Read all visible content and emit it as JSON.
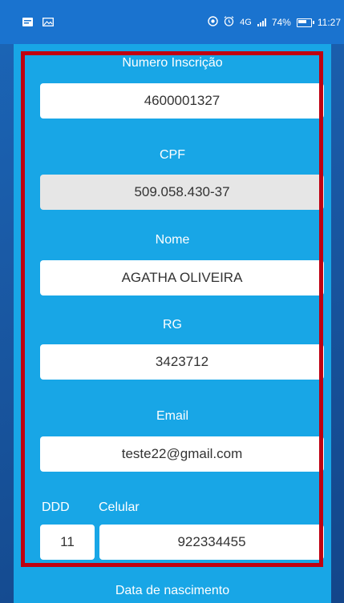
{
  "status_bar": {
    "network": "4G",
    "battery": "74%",
    "time": "11:27"
  },
  "form": {
    "numero_inscricao": {
      "label": "Numero Inscrição",
      "value": "4600001327"
    },
    "cpf": {
      "label": "CPF",
      "value": "509.058.430-37"
    },
    "nome": {
      "label": "Nome",
      "value": "AGATHA OLIVEIRA"
    },
    "rg": {
      "label": "RG",
      "value": "3423712"
    },
    "email": {
      "label": "Email",
      "value": "teste22@gmail.com"
    },
    "ddd": {
      "label": "DDD",
      "value": "11"
    },
    "celular": {
      "label": "Celular",
      "value": "922334455"
    },
    "data_nascimento": {
      "label": "Data de nascimento"
    }
  }
}
